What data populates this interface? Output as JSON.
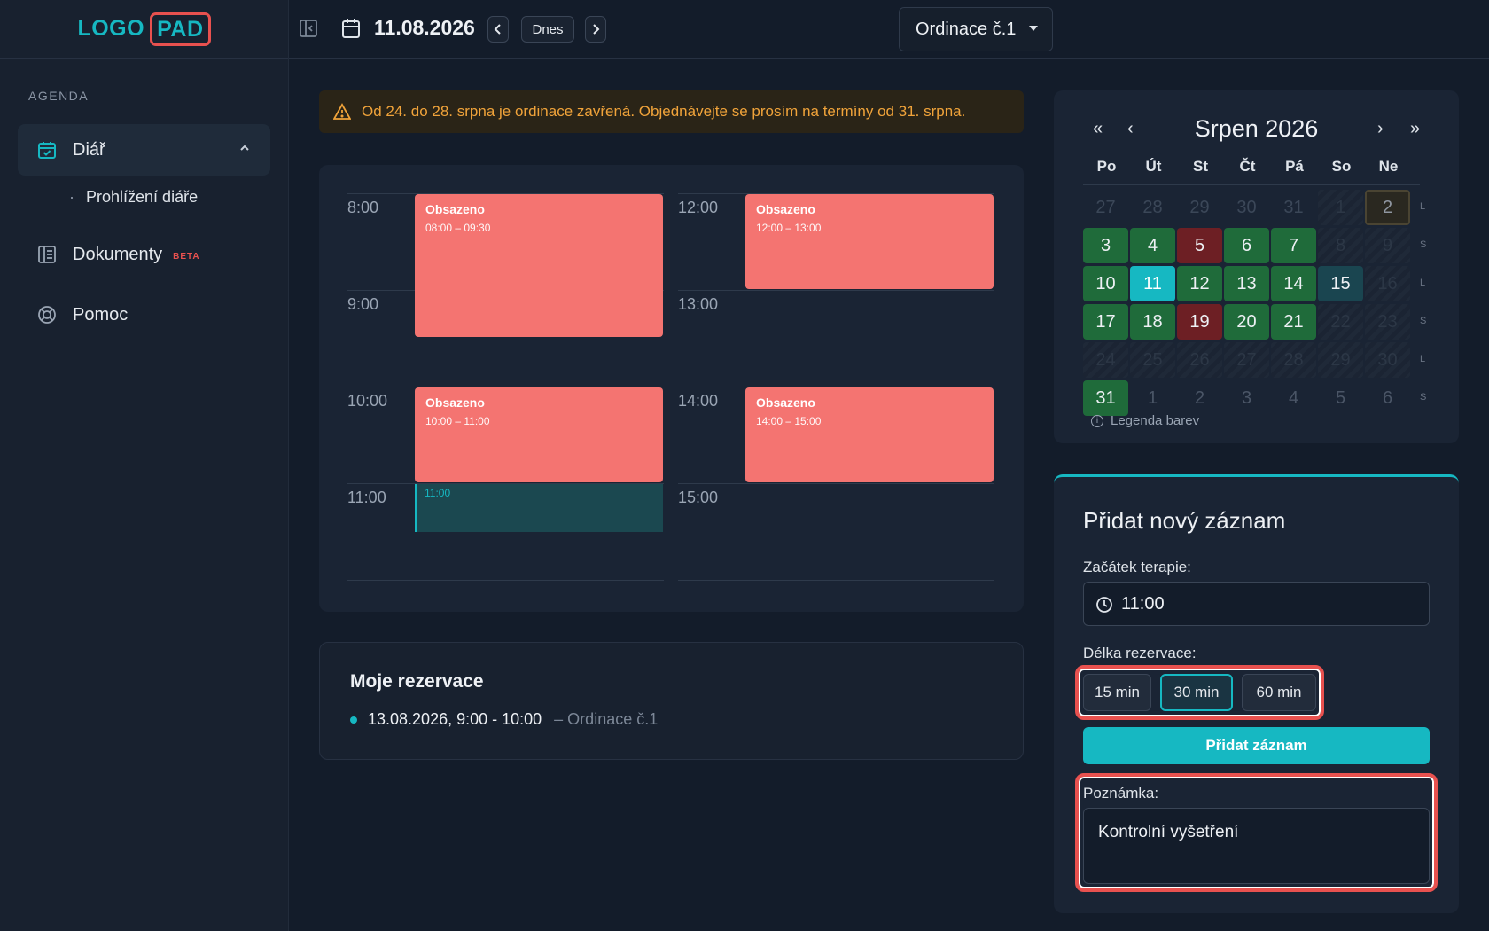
{
  "logo": {
    "part1": "LOGO",
    "part2": "PAD"
  },
  "sidebar": {
    "section": "AGENDA",
    "items": [
      {
        "label": "Diář",
        "icon": "calendar-check-icon"
      },
      {
        "label": "Dokumenty",
        "badge": "BETA",
        "icon": "document-icon"
      },
      {
        "label": "Pomoc",
        "icon": "lifebuoy-icon"
      }
    ],
    "sub_items": [
      {
        "label": "Prohlížení diáře"
      }
    ]
  },
  "topbar": {
    "date": "11.08.2026",
    "today_label": "Dnes",
    "prev_icon": "chevron-left-icon",
    "next_icon": "chevron-right-icon",
    "room_select": "Ordinace č.1"
  },
  "notice": {
    "text": "Od 24. do 28. srpna je ordinace zavřená. Objednávejte se prosím na termíny od 31. srpna."
  },
  "schedule": {
    "left_hours": [
      "8:00",
      "9:00",
      "10:00",
      "11:00"
    ],
    "right_hours": [
      "12:00",
      "13:00",
      "14:00",
      "15:00"
    ],
    "events": [
      {
        "title": "Obsazeno",
        "time": "08:00 – 09:30"
      },
      {
        "title": "Obsazeno",
        "time": "10:00 – 11:00"
      },
      {
        "title": "Obsazeno",
        "time": "12:00 – 13:00"
      },
      {
        "title": "Obsazeno",
        "time": "14:00 – 15:00"
      }
    ],
    "selected_slot": "11:00"
  },
  "reservations": {
    "title": "Moje rezervace",
    "items": [
      {
        "when": "13.08.2026, 9:00 - 10:00",
        "where": "– Ordinace č.1"
      }
    ]
  },
  "calendar": {
    "title": "Srpen 2026",
    "nav": {
      "first": "«",
      "prev": "‹",
      "next": "›",
      "last": "»"
    },
    "weekdays": [
      "Po",
      "Út",
      "St",
      "Čt",
      "Pá",
      "So",
      "Ne"
    ],
    "week_tags": [
      "L",
      "S",
      "L",
      "S",
      "L",
      "S"
    ],
    "weeks": [
      [
        "27",
        "28",
        "29",
        "30",
        "31",
        "1",
        "2"
      ],
      [
        "3",
        "4",
        "5",
        "6",
        "7",
        "8",
        "9"
      ],
      [
        "10",
        "11",
        "12",
        "13",
        "14",
        "15",
        "16"
      ],
      [
        "17",
        "18",
        "19",
        "20",
        "21",
        "22",
        "23"
      ],
      [
        "24",
        "25",
        "26",
        "27",
        "28",
        "29",
        "30"
      ],
      [
        "31",
        "1",
        "2",
        "3",
        "4",
        "5",
        "6"
      ]
    ],
    "legend": "Legenda barev"
  },
  "form": {
    "title": "Přidat nový záznam",
    "start_label": "Začátek terapie:",
    "start_value": "11:00",
    "duration_label": "Délka rezervace:",
    "durations": [
      "15 min",
      "30 min",
      "60 min"
    ],
    "selected_duration": "30 min",
    "submit_label": "Přidat záznam",
    "note_label": "Poznámka:",
    "note_value": "Kontrolní vyšetření"
  },
  "colors": {
    "accent": "#16b8c2",
    "busy": "#f47471",
    "available_day": "#1f6b3a",
    "closed_day": "#6d1f24",
    "warning": "#f0a33a",
    "highlight": "#e8514f"
  }
}
